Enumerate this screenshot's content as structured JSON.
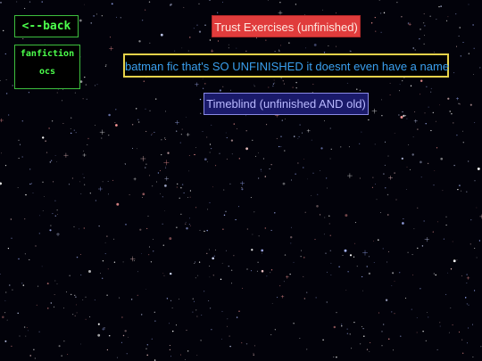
{
  "nav": {
    "back_label": "<--back",
    "links": [
      {
        "label": "fanfiction"
      },
      {
        "label": "ocs"
      }
    ]
  },
  "stories": [
    {
      "title": "Trust Exercises (unfinished)",
      "color": "#e03c3c"
    },
    {
      "title": "batman fic that's SO UNFINISHED it doesnt even have a name",
      "color": "#3aa0ee"
    },
    {
      "title": "Timeblind (unfinished AND old)",
      "color": "#1a1a6a"
    }
  ],
  "theme": {
    "background": "#02020a",
    "nav_accent": "#4cff4c"
  }
}
